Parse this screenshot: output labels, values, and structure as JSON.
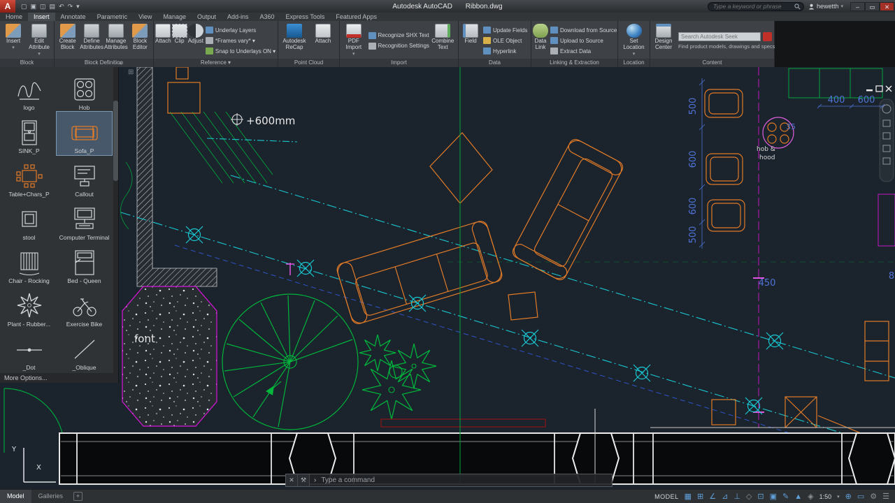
{
  "title_bar": {
    "app_initial": "A",
    "quick_access_icons": [
      "▢",
      "▣",
      "◫",
      "▤",
      "↶",
      "↷",
      "▾"
    ],
    "title_app": "Autodesk AutoCAD",
    "title_doc": "Ribbon.dwg",
    "search_placeholder": "Type a keyword or phrase",
    "user_name": "hewetth",
    "caret": "▾",
    "window": {
      "minimize": "–",
      "maximize": "▭",
      "close": "✕"
    }
  },
  "ribbon_tabs": {
    "items": [
      "Home",
      "Insert",
      "Annotate",
      "Parametric",
      "View",
      "Manage",
      "Output",
      "Add-ins",
      "A360",
      "Express Tools",
      "Featured Apps"
    ]
  },
  "ribbon": {
    "caret": "▾",
    "block": {
      "label": "Block",
      "insert": "Insert",
      "edit_attribute": "Edit Attribute"
    },
    "block_definition": {
      "label": "Block Definition",
      "create": "Create Block",
      "define": "Define Attributes",
      "manage": "Manage Attributes",
      "editor": "Block Editor"
    },
    "reference": {
      "label": "Reference ▾",
      "attach": "Attach",
      "clip": "Clip",
      "adjust": "Adjust",
      "underlay_layers": "Underlay Layers",
      "frames": "*Frames vary* ▾",
      "snap": "Snap to Underlays ON ▾"
    },
    "point_cloud": {
      "label": "Point Cloud",
      "recap": "Autodesk ReCap",
      "attach": "Attach"
    },
    "import": {
      "label": "Import",
      "pdf": "PDF Import",
      "recognize": "Recognize SHX Text",
      "settings": "Recognition Settings",
      "combine": "Combine Text"
    },
    "data": {
      "label": "Data",
      "field": "Field",
      "update": "Update Fields",
      "ole": "OLE Object",
      "hyperlink": "Hyperlink"
    },
    "linking": {
      "label": "Linking & Extraction",
      "data_link": "Data Link",
      "download": "Download from Source",
      "upload": "Upload to Source",
      "extract": "Extract Data"
    },
    "location": {
      "label": "Location",
      "set_location": "Set Location"
    },
    "content": {
      "label": "Content",
      "design_center": "Design Center",
      "seek_placeholder": "Search Autodesk Seek",
      "seek_hint": "Find product models, drawings and specs"
    }
  },
  "palette": {
    "items": [
      {
        "label": "logo"
      },
      {
        "label": "Hob"
      },
      {
        "label": "SINK_P"
      },
      {
        "label": "Sofa_P"
      },
      {
        "label": "Table+Chars_P"
      },
      {
        "label": "Callout"
      },
      {
        "label": "stool"
      },
      {
        "label": "Computer Terminal"
      },
      {
        "label": "Chair - Rocking"
      },
      {
        "label": "Bed - Queen"
      },
      {
        "label": "Plant - Rubber..."
      },
      {
        "label": "Exercise Bike"
      },
      {
        "label": "_Dot"
      },
      {
        "label": "_Oblique"
      }
    ],
    "selected": "Sofa_P",
    "more_options": "More Options..."
  },
  "canvas": {
    "elevation_label": "+600mm",
    "font_label": "font",
    "hob_label_line1": "hob &",
    "hob_label_line2": "hood",
    "dims_vertical": [
      "500",
      "600",
      "600",
      "500"
    ],
    "dim_400": "400",
    "dim_600": "600",
    "dim_450": "450",
    "dim_35": "35",
    "dim_8": "8",
    "ucs_y": "Y",
    "ucs_x": "X",
    "collapse_glyph": "◂",
    "grid_glyph": "⊞"
  },
  "command_line": {
    "close_glyph": "✕",
    "tool_glyph": "⚒",
    "prompt_glyph": "›",
    "placeholder": "Type a command"
  },
  "status_bar": {
    "model_tab": "Model",
    "galleries_tab": "Galleries",
    "add_tab": "+",
    "space_label": "MODEL",
    "scale_label": "1:50",
    "icons": [
      "▦",
      "⊞",
      "∠",
      "⊿",
      "⊥",
      "◇",
      "⊡",
      "▣",
      "✎",
      "▲",
      "◈",
      "⊕",
      "▭",
      "⚙",
      "☰"
    ]
  }
}
